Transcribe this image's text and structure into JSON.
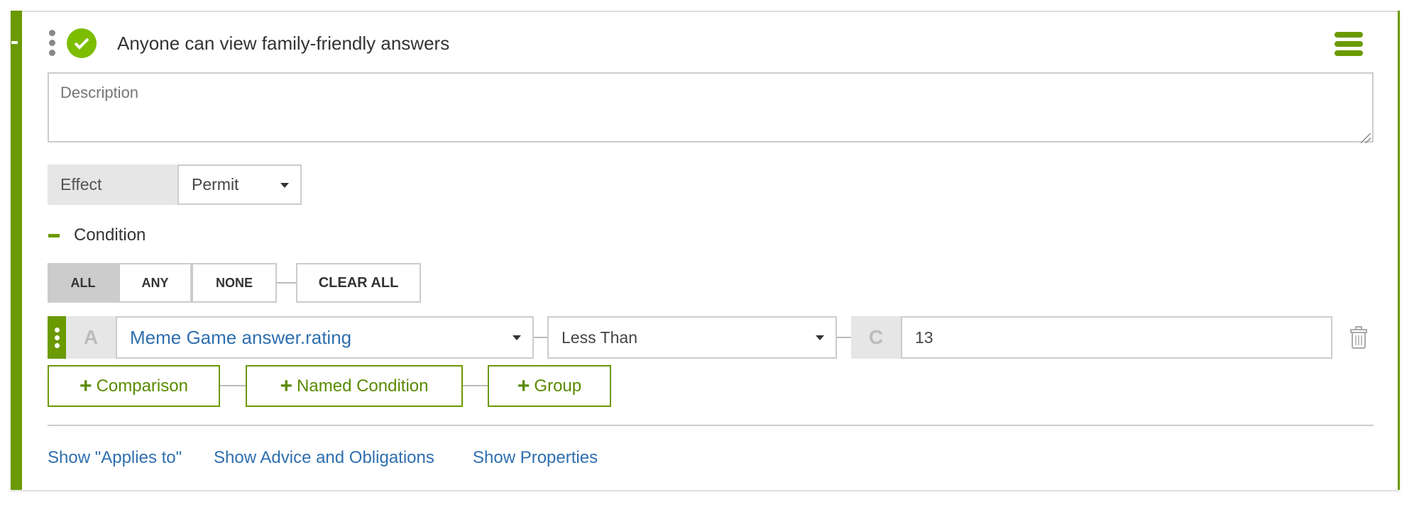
{
  "rule": {
    "title": "Anyone can view family-friendly answers",
    "status_icon": "check-circle-icon",
    "description_placeholder": "Description"
  },
  "effect": {
    "label": "Effect",
    "value": "Permit"
  },
  "condition": {
    "label": "Condition",
    "modes": [
      "ALL",
      "ANY",
      "NONE"
    ],
    "active_mode": "ALL",
    "clear_all": "CLEAR ALL"
  },
  "comparison": {
    "left_tag": "A",
    "attribute": "Meme Game answer.rating",
    "operator": "Less Than",
    "right_tag": "C",
    "value": "13"
  },
  "add_buttons": {
    "comparison": "Comparison",
    "named_condition": "Named Condition",
    "group": "Group",
    "plus": "+"
  },
  "links": {
    "applies_to": "Show \"Applies to\"",
    "advice": "Show Advice and Obligations",
    "properties": "Show Properties"
  },
  "colors": {
    "accent": "#6a9a00",
    "check": "#7dbd00",
    "link": "#2f6fae"
  }
}
